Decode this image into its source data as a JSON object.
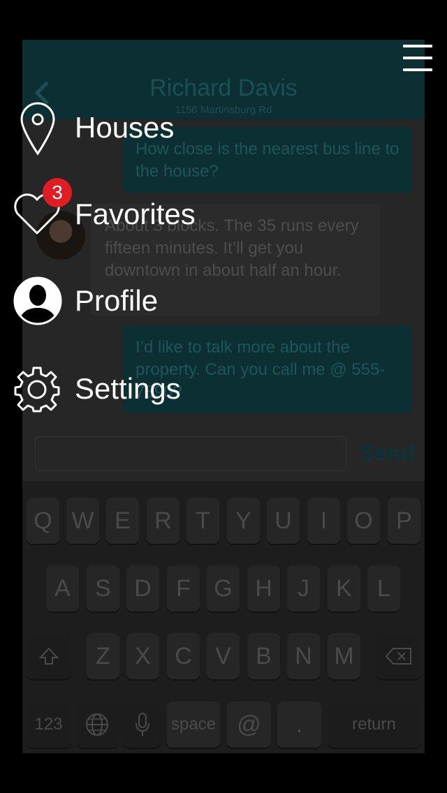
{
  "chat": {
    "contact_name": "Richard Davis",
    "contact_address": "1156 Martinsburg Rd",
    "messages": [
      {
        "from": "me",
        "text": "How close is the nearest bus line to the house?"
      },
      {
        "from": "contact",
        "text": "About 3 blocks. The 35 runs every fifteen minutes. It’ll get you downtown in about half an hour."
      },
      {
        "from": "me",
        "text": "I’d like to talk more about the property. Can you call me @ 555-7890?"
      }
    ],
    "input_placeholder": "",
    "send_label": "Send"
  },
  "keyboard": {
    "row1": [
      "Q",
      "W",
      "E",
      "R",
      "T",
      "Y",
      "U",
      "I",
      "O",
      "P"
    ],
    "row2": [
      "A",
      "S",
      "D",
      "F",
      "G",
      "H",
      "J",
      "K",
      "L"
    ],
    "row3": [
      "Z",
      "X",
      "C",
      "V",
      "B",
      "N",
      "M"
    ],
    "numbers_label": "123",
    "space_label": "space",
    "at_label": "@",
    "period_label": ".",
    "return_label": "return"
  },
  "menu": {
    "items": [
      {
        "label": "Houses",
        "icon": "map-pin-icon"
      },
      {
        "label": "Favorites",
        "icon": "heart-icon",
        "badge": "3"
      },
      {
        "label": "Profile",
        "icon": "user-circle-icon"
      },
      {
        "label": "Settings",
        "icon": "gear-icon"
      }
    ],
    "badge_color": "#e11d24"
  },
  "colors": {
    "accent_dim": "#0b2f33",
    "menu_text": "#ffffff"
  }
}
